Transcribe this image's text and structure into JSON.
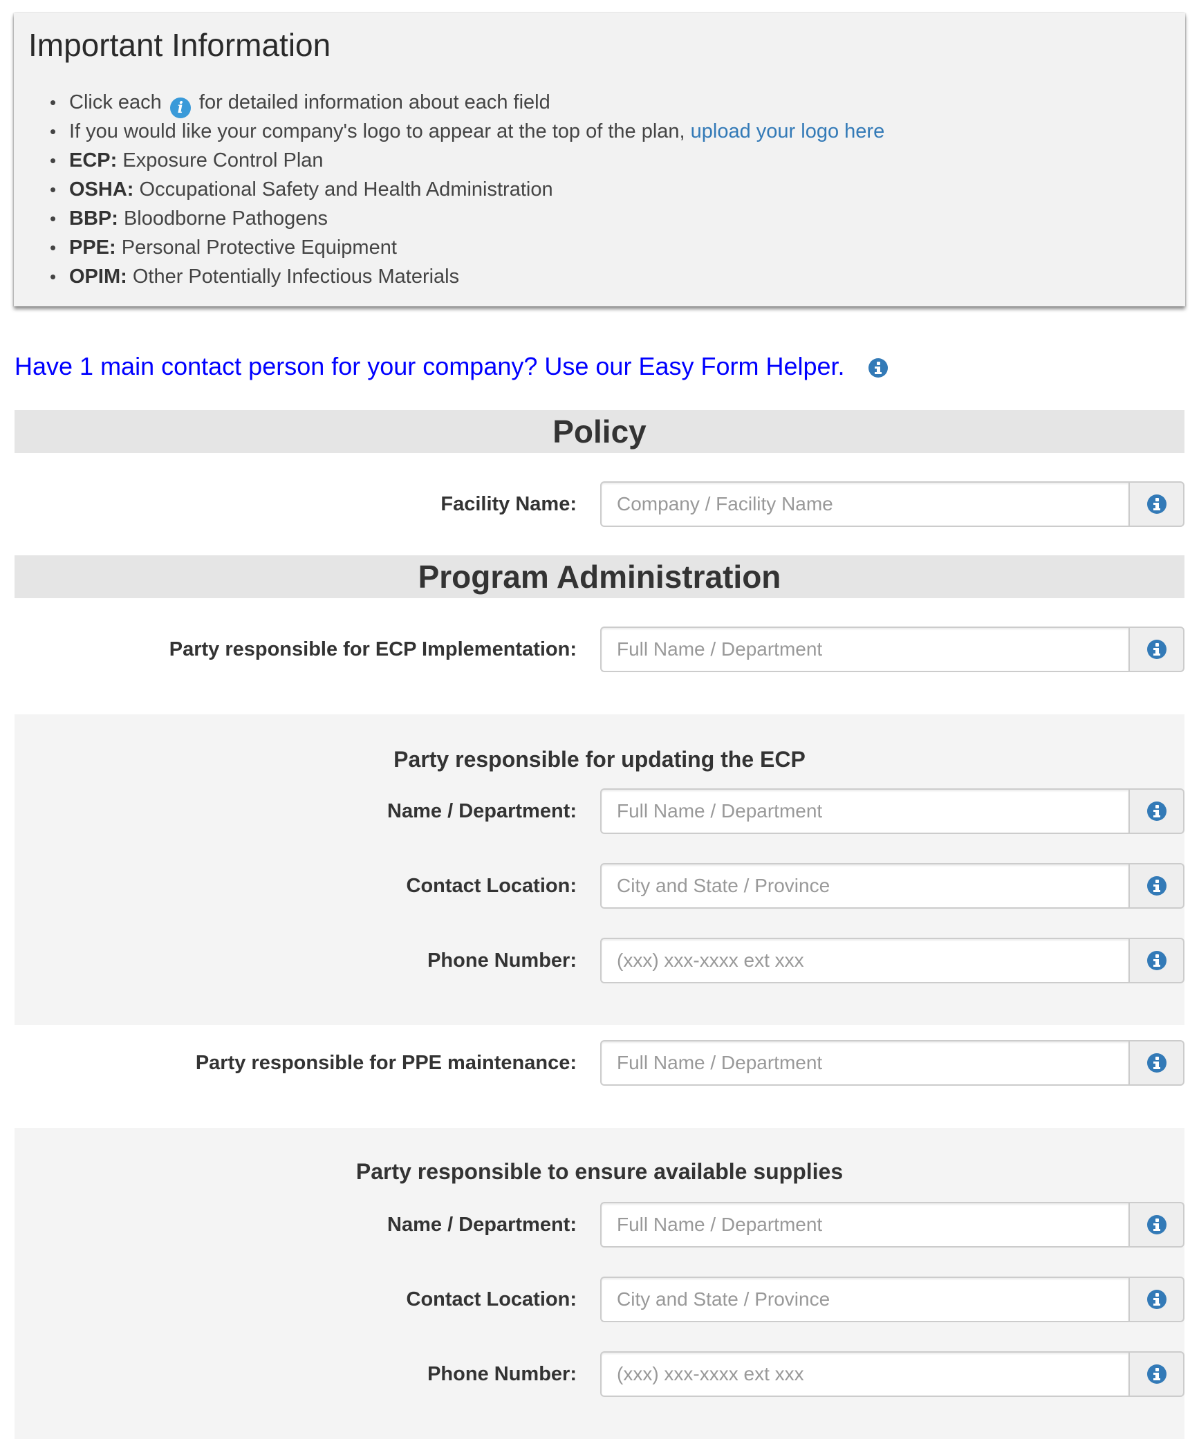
{
  "info": {
    "title": "Important Information",
    "items": [
      {
        "pre": "Click each",
        "post": "for detailed information about each field"
      },
      {
        "text": "If you would like your company's logo to appear at the top of the plan,",
        "link": "upload your logo here"
      },
      {
        "abbr": "ECP:",
        "text": "Exposure Control Plan"
      },
      {
        "abbr": "OSHA:",
        "text": "Occupational Safety and Health Administration"
      },
      {
        "abbr": "BBP:",
        "text": "Bloodborne Pathogens"
      },
      {
        "abbr": "PPE:",
        "text": "Personal Protective Equipment"
      },
      {
        "abbr": "OPIM:",
        "text": "Other Potentially Infectious Materials"
      }
    ],
    "inline_icon": "i"
  },
  "helper_link": "Have 1 main contact person for your company? Use our Easy Form Helper.",
  "sections": {
    "policy": "Policy",
    "program_admin": "Program Administration"
  },
  "fields": {
    "facility_name": {
      "label": "Facility Name:",
      "placeholder": "Company / Facility Name"
    },
    "ecp_implementation": {
      "label": "Party responsible for ECP Implementation:",
      "placeholder": "Full Name / Department"
    },
    "updating_ecp": {
      "heading": "Party responsible for updating the ECP",
      "name": {
        "label": "Name / Department:",
        "placeholder": "Full Name / Department"
      },
      "location": {
        "label": "Contact Location:",
        "placeholder": "City and State / Province"
      },
      "phone": {
        "label": "Phone Number:",
        "placeholder": "(xxx) xxx-xxxx ext xxx"
      }
    },
    "ppe_maintenance": {
      "label": "Party responsible for PPE maintenance:",
      "placeholder": "Full Name / Department"
    },
    "supplies": {
      "heading": "Party responsible to ensure available supplies",
      "name": {
        "label": "Name / Department:",
        "placeholder": "Full Name / Department"
      },
      "location": {
        "label": "Contact Location:",
        "placeholder": "City and State / Province"
      },
      "phone": {
        "label": "Phone Number:",
        "placeholder": "(xxx) xxx-xxxx ext xxx"
      }
    }
  },
  "colors": {
    "info_icon": "#337ab7",
    "helper_link": "#0000ff",
    "upload_link": "#337ab7",
    "section_bar": "#e5e5e5",
    "gray_block": "#f4f4f4"
  }
}
